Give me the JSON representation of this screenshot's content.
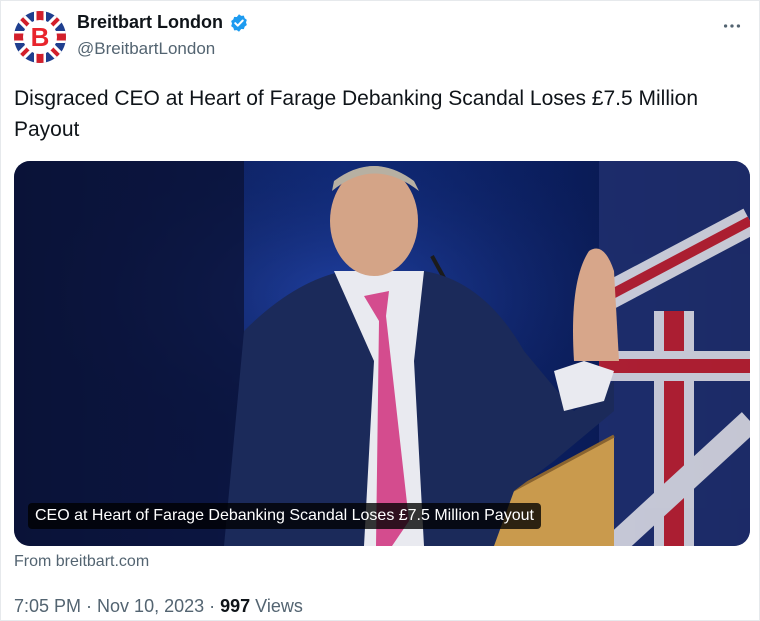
{
  "author": {
    "display_name": "Breitbart London",
    "handle": "@BreitbartLondon",
    "verified": true,
    "avatar_letter": "B",
    "verified_color": "#1d9bf0"
  },
  "tweet": {
    "text": "Disgraced CEO at Heart of Farage Debanking Scandal Loses £7.5 Million Payout"
  },
  "card": {
    "caption": "CEO at Heart of Farage Debanking Scandal Loses £7.5 Million Payout",
    "source": "From breitbart.com"
  },
  "meta": {
    "time": "7:05 PM",
    "separator": " · ",
    "date": "Nov 10, 2023",
    "views_count": "997",
    "views_label": " Views"
  },
  "icons": {
    "more": "more-options-icon",
    "verified": "verified-badge-icon"
  }
}
